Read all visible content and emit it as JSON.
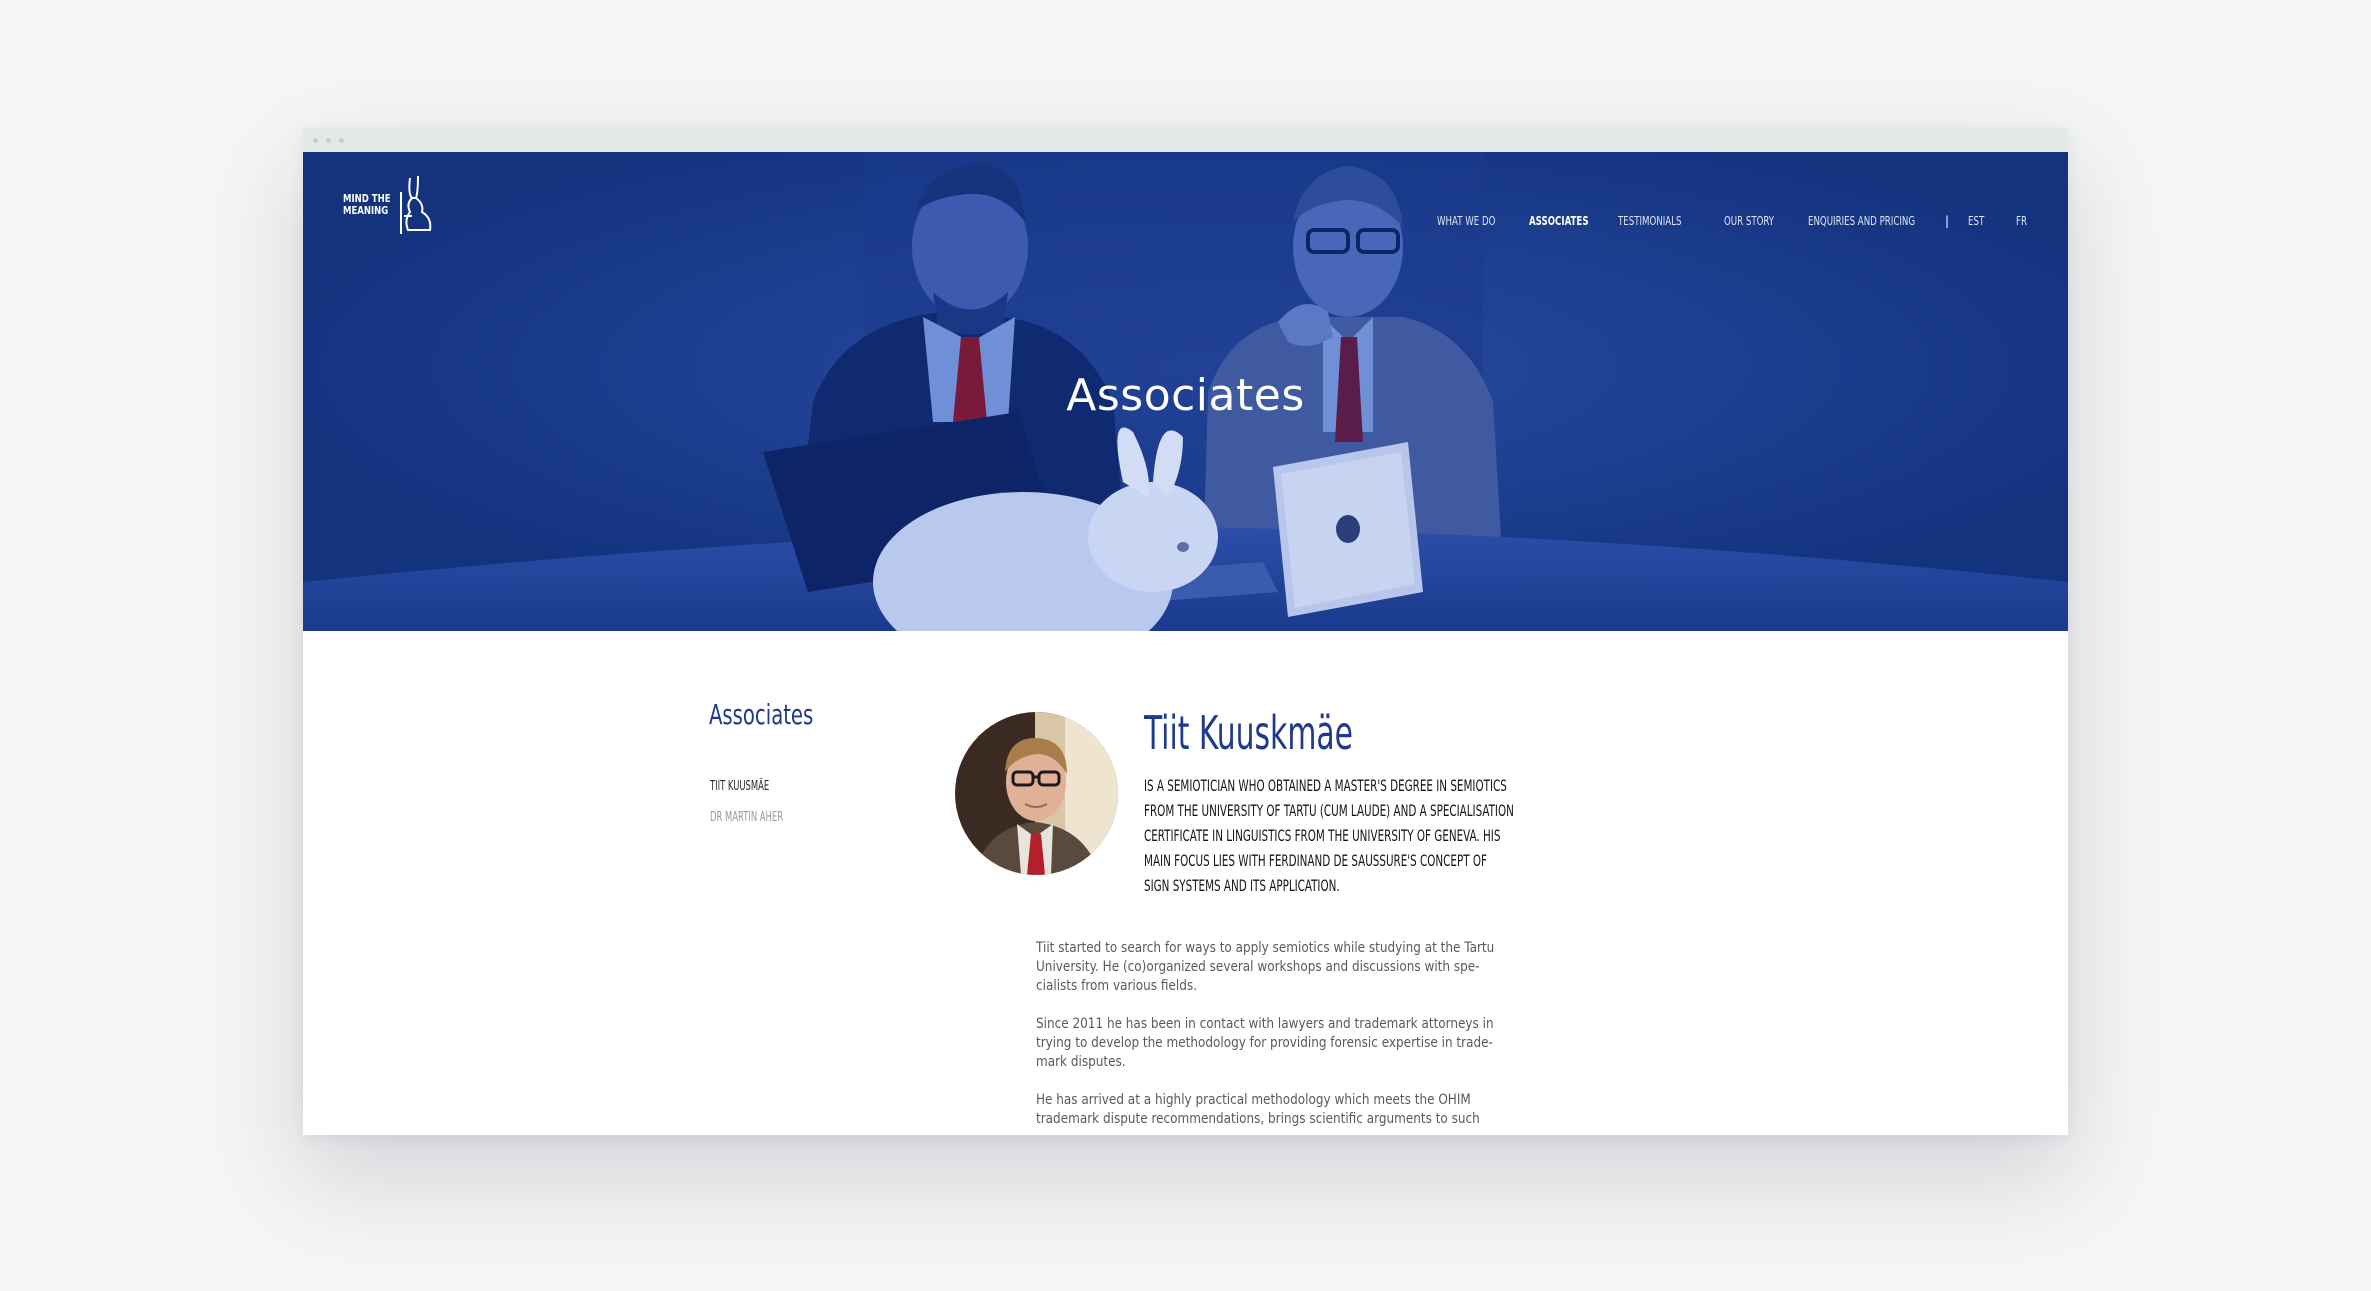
{
  "header": {
    "logo_line1": "MIND THE",
    "logo_line2": "MEANING",
    "nav": [
      {
        "label": "WHAT WE DO"
      },
      {
        "label": "ASSOCIATES"
      },
      {
        "label": "TESTIMONIALS"
      },
      {
        "label": "OUR STORY"
      },
      {
        "label": "ENQUIRIES AND PRICING"
      }
    ],
    "separator": "|",
    "lang": [
      {
        "label": "EST"
      },
      {
        "label": "FR"
      }
    ]
  },
  "hero": {
    "title": "Associates"
  },
  "sidebar": {
    "title": "Associates",
    "items": [
      {
        "label": "TIIT KUUSMÄE"
      },
      {
        "label": "DR MARTIN AHER"
      }
    ]
  },
  "profile": {
    "name": "Tiit Kuuskmäe",
    "intro_lines": [
      "IS A SEMIOTICIAN WHO OBTAINED A MASTER'S DEGREE IN SEMIOTICS",
      "FROM THE UNIVERSITY OF TARTU (CUM LAUDE) AND A SPECIALISATION",
      "CERTIFICATE IN LINGUISTICS FROM THE UNIVERSITY OF GENEVA. HIS",
      "MAIN FOCUS LIES WITH FERDINAND DE SAUSSURE'S CONCEPT OF",
      "SIGN SYSTEMS AND ITS APPLICATION."
    ],
    "paragraphs": [
      [
        "Tiit started to search for ways to apply semiotics while studying at the Tartu",
        "University. He (co)organized several workshops and discussions with spe-",
        "cialists from various fields."
      ],
      [
        "Since 2011 he has been in contact with lawyers and trademark attorneys in",
        "trying to develop the methodology for providing forensic expertise in trade-",
        "mark disputes."
      ],
      [
        "He has arrived at a highly practical methodology which meets the OHIM",
        "trademark dispute recommendations, brings scientific arguments to such"
      ]
    ]
  },
  "colors": {
    "brand_blue": "#13337f",
    "heading_blue": "#1f3a8a",
    "page_bg": "#f4f5f5"
  }
}
